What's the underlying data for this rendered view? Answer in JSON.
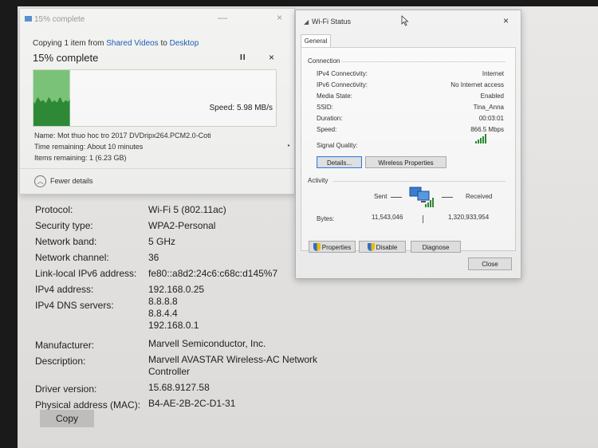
{
  "copy_dialog": {
    "title": "15% complete",
    "copying_prefix": "Copying 1 item from",
    "source": "Shared Videos",
    "to_word": "to",
    "destination": "Desktop",
    "progress_label": "15% complete",
    "progress_percent": 15,
    "pause_label": "II",
    "cancel_label": "×",
    "speed_label": "Speed: 5.98 MB/s",
    "name_label": "Name:  Mot thuo hoc tro 2017 DVDripx264.PCM2.0-Coti",
    "time_remaining_label": "Time remaining:  About 10 minutes",
    "items_remaining_label": "Items remaining:  1 (6.23 GB)",
    "fewer_details_label": "Fewer details",
    "minimize_glyph": "—",
    "close_glyph": "×"
  },
  "properties": [
    {
      "label": "Protocol:",
      "value": "Wi-Fi 5 (802.11ac)"
    },
    {
      "label": "Security type:",
      "value": "WPA2-Personal"
    },
    {
      "label": "Network band:",
      "value": "5 GHz"
    },
    {
      "label": "Network channel:",
      "value": "36"
    },
    {
      "label": "Link-local IPv6 address:",
      "value": "fe80::a8d2:24c6:c68c:d145%7"
    },
    {
      "label": "IPv4 address:",
      "value": "192.168.0.25"
    },
    {
      "label": "IPv4 DNS servers:",
      "value_lines": [
        "8.8.8.8",
        "8.8.4.4",
        "192.168.0.1"
      ]
    },
    {
      "label": "Manufacturer:",
      "value": "Marvell Semiconductor, Inc."
    },
    {
      "label": "Description:",
      "value_lines": [
        "Marvell AVASTAR Wireless-AC Network",
        "Controller"
      ]
    },
    {
      "label": "Driver version:",
      "value": "15.68.9127.58"
    },
    {
      "label": "Physical address (MAC):",
      "value": "B4-AE-2B-2C-D1-31"
    }
  ],
  "copy_button_label": "Copy",
  "wifi_status": {
    "title": "Wi-Fi Status",
    "close_glyph": "×",
    "tab_general": "General",
    "connection_heading": "Connection",
    "rows": [
      {
        "label": "IPv4 Connectivity:",
        "value": "Internet"
      },
      {
        "label": "IPv6 Connectivity:",
        "value": "No Internet access"
      },
      {
        "label": "Media State:",
        "value": "Enabled"
      },
      {
        "label": "SSID:",
        "value": "Tina_Anna"
      },
      {
        "label": "Duration:",
        "value": "00:03:01"
      },
      {
        "label": "Speed:",
        "value": "866.5 Mbps"
      }
    ],
    "signal_quality_label": "Signal Quality:",
    "details_button": "Details...",
    "wireless_properties_button": "Wireless Properties",
    "activity_heading": "Activity",
    "sent_label": "Sent",
    "received_label": "Received",
    "bytes_label": "Bytes:",
    "bytes_sent": "11,543,046",
    "bytes_received": "1,320,933,954",
    "properties_button": "Properties",
    "disable_button": "Disable",
    "diagnose_button": "Diagnose",
    "close_button": "Close"
  }
}
